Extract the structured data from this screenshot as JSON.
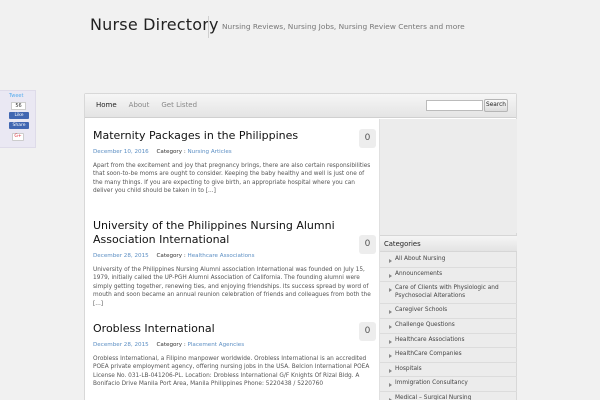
{
  "header": {
    "title": "Nurse Directory",
    "tagline": "Nursing Reviews, Nursing Jobs, Nursing Review Centers and more"
  },
  "social": {
    "tweet": "Tweet",
    "like_count": "56",
    "like": "Like",
    "share": "Share",
    "gplus": "G+"
  },
  "nav": {
    "items": [
      {
        "label": "Home"
      },
      {
        "label": "About"
      },
      {
        "label": "Get Listed"
      }
    ],
    "search_placeholder": "",
    "search_button": "Search"
  },
  "posts": [
    {
      "title": "Maternity Packages in the Philippines",
      "comments": "0",
      "date": "December 10, 2016",
      "category_label": "Category :",
      "category": "Nursing Articles",
      "excerpt": "Apart from the excitement and joy that pregnancy brings, there are also certain responsibilities that soon-to-be moms are ought to consider. Keeping the baby healthy and well is just one of the many things. If you are expecting to give birth, an appropriate hospital where you can deliver you child should be taken in to [...]"
    },
    {
      "title": "University of the Philippines Nursing Alumni Association International",
      "comments": "0",
      "date": "December 28, 2015",
      "category_label": "Category :",
      "category": "Healthcare Associations",
      "excerpt": "University of the Philippines Nursing Alumni association International was founded on July 15, 1979, initially called the UP-PGH Alumni Association of California. The founding alumni were simply getting together, renewing ties, and enjoying friendships. Its success spread by word of mouth and soon became an annual reunion celebration of friends and colleagues from both the [...]"
    },
    {
      "title": "Orobless International",
      "comments": "0",
      "date": "December 28, 2015",
      "category_label": "Category :",
      "category": "Placement Agencies",
      "excerpt": "Orobless International, a Filipino manpower worldwide. Orobless International is an accredited POEA private employment agency, offering nursing jobs in the USA. Belcion International POEA License No. 031-LB-041206-PL. Location: Drobless International G/F Knights Of Rizal Bldg. A Bonifacio Drive Manila Port Area, Manila Philippines Phone: 5220438 / 5220760"
    }
  ],
  "sidebar": {
    "categories_heading": "Categories",
    "categories": [
      "All About Nursing",
      "Announcements",
      "Care of Clients with Physiologic and Psychosocial Alterations",
      "Caregiver Schools",
      "Challenge Questions",
      "Healthcare Associations",
      "HealthCare Companies",
      "Hospitals",
      "Immigration Consultancy",
      "Medical – Surgical Nursing"
    ]
  }
}
